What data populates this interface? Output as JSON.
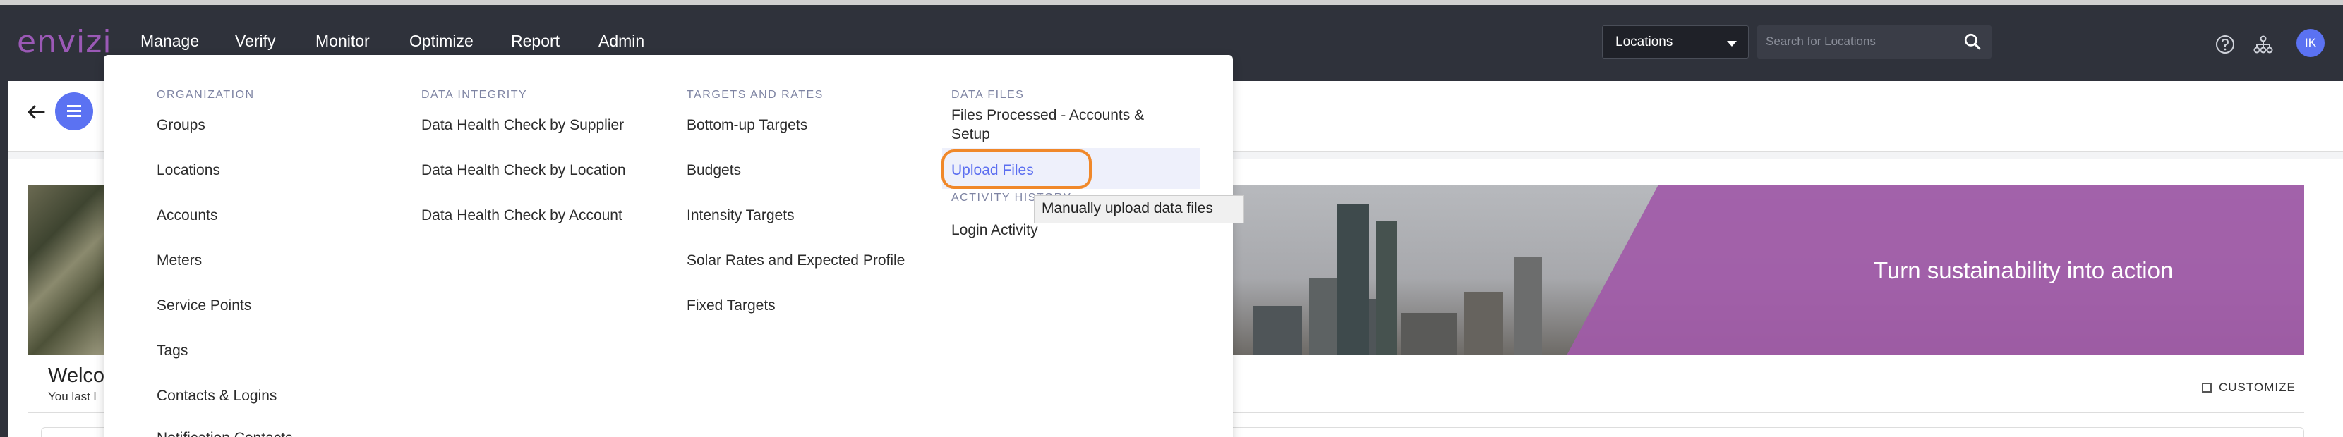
{
  "app": {
    "logo": "envizi"
  },
  "nav": {
    "items": [
      "Manage",
      "Verify",
      "Monitor",
      "Optimize",
      "Report",
      "Admin"
    ]
  },
  "search": {
    "scope": "Locations",
    "placeholder": "Search for Locations"
  },
  "user": {
    "initials": "IK"
  },
  "menu": {
    "organization": {
      "heading": "ORGANIZATION",
      "items": [
        "Groups",
        "Locations",
        "Accounts",
        "Meters",
        "Service Points",
        "Tags",
        "Contacts & Logins",
        "Notification Contacts"
      ]
    },
    "data_integrity": {
      "heading": "DATA INTEGRITY",
      "items": [
        "Data Health Check by Supplier",
        "Data Health Check by Location",
        "Data Health Check by Account"
      ]
    },
    "targets_rates": {
      "heading": "TARGETS AND RATES",
      "items": [
        "Bottom-up Targets",
        "Budgets",
        "Intensity Targets",
        "Solar Rates and Expected Profile",
        "Fixed Targets"
      ]
    },
    "data_files": {
      "heading": "DATA FILES",
      "items": [
        "Files Processed - Accounts &",
        "Setup",
        "Upload Files"
      ]
    },
    "activity": {
      "heading": "ACTIVITY HISTORY",
      "items": [
        "Login Activity"
      ]
    }
  },
  "tooltip": {
    "text": "Manually upload data files"
  },
  "dashboard": {
    "banner_text": "Turn sustainability into action",
    "welcome": "Welco",
    "last_login": "You last l",
    "customize": "CUSTOMIZE"
  }
}
